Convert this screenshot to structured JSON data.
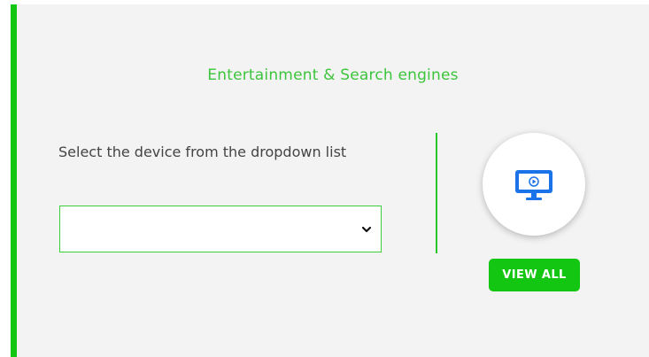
{
  "section": {
    "title": "Entertainment & Search engines",
    "instruction": "Select the device from the dropdown list"
  },
  "device_select": {
    "selected": ""
  },
  "device_icon": {
    "name": "monitor-play-icon",
    "color": "#1a73e8"
  },
  "actions": {
    "view_all_label": "VIEW ALL"
  },
  "colors": {
    "accent": "#12c612",
    "title_text": "#3cc43c",
    "background": "#f3f3f3"
  }
}
